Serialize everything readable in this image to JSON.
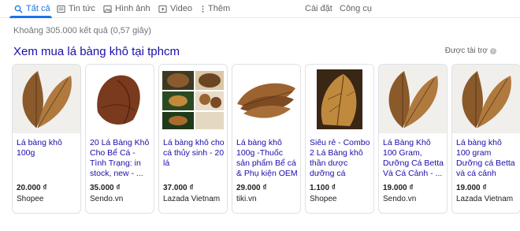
{
  "tabs": [
    {
      "label": "Tất cả",
      "icon": "search-icon",
      "active": true
    },
    {
      "label": "Tin tức",
      "icon": "news-icon",
      "active": false
    },
    {
      "label": "Hình ảnh",
      "icon": "image-icon",
      "active": false
    },
    {
      "label": "Video",
      "icon": "video-icon",
      "active": false
    },
    {
      "label": "Thêm",
      "icon": "more-vert-icon",
      "active": false
    }
  ],
  "tools": {
    "settings": "Cài đặt",
    "tools": "Công cụ"
  },
  "result_count": "Khoảng 305.000 kết quả (0,57 giây)",
  "shopping": {
    "title": "Xem mua lá bàng khô tại tphcm",
    "sponsored": "Được tài trợ",
    "products": [
      {
        "name": "Lá bàng khô 100g",
        "price": "20.000 ₫",
        "store": "Shopee"
      },
      {
        "name": "20 Lá Bàng Khô Cho Bể Cá - Tình Trạng: in stock, new - ...",
        "price": "35.000 ₫",
        "store": "Sendo.vn"
      },
      {
        "name": "Lá bàng khô cho cá thủy sinh - 20 lá",
        "price": "37.000 ₫",
        "store": "Lazada Vietnam"
      },
      {
        "name": "Lá bàng khô 100g -Thuốc sản phẩm Bể cá & Phụ kiện OEM",
        "price": "29.000 ₫",
        "store": "tiki.vn"
      },
      {
        "name": "Siêu rẻ - Combo 2 Lá Bàng khô thần dược dưỡng cá",
        "price": "1.100 ₫",
        "store": "Shopee"
      },
      {
        "name": "Lá Bàng Khô 100 Gram, Dưỡng Cá Betta Và Cá Cảnh - ...",
        "price": "19.000 ₫",
        "store": "Sendo.vn"
      },
      {
        "name": "Lá bàng khô 100 gram Dưỡng cá Betta và cá cảnh",
        "price": "19.000 ₫",
        "store": "Lazada Vietnam"
      }
    ]
  },
  "colors": {
    "link": "#1a0dab",
    "accent": "#1a73e8",
    "muted": "#70757a"
  }
}
